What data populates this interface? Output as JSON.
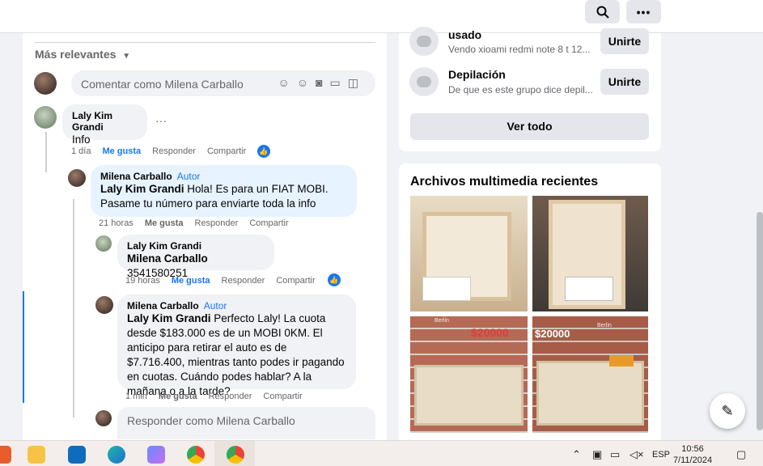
{
  "topbar": {
    "search_icon": "search-icon",
    "more_icon": "more-icon"
  },
  "comments": {
    "sort_label": "Más relevantes",
    "composer_placeholder": "Comentar como Milena Carballo",
    "reply_placeholder": "Responder como Milena Carballo",
    "items": [
      {
        "author": "Laly Kim Grandi",
        "badge": "",
        "mention": "",
        "text": "Info",
        "time": "1 día",
        "like": "Me gusta",
        "reply": "Responder",
        "share": "Compartir"
      },
      {
        "author": "Milena Carballo",
        "badge": "Autor",
        "mention": "Laly Kim Grandi",
        "text": " Hola! Es para un FIAT MOBI. Pasame tu número para enviarte toda la info",
        "time": "21 horas",
        "like": "Me gusta",
        "reply": "Responder",
        "share": "Compartir"
      },
      {
        "author": "Laly Kim Grandi",
        "badge": "",
        "mention": "Milena Carballo",
        "text": " 3541580251",
        "time": "19 horas",
        "like": "Me gusta",
        "reply": "Responder",
        "share": "Compartir"
      },
      {
        "author": "Milena Carballo",
        "badge": "Autor",
        "mention": "Laly Kim Grandi",
        "text": " Perfecto Laly! La cuota desde $183.000 es de un MOBI 0KM. El anticipo para retirar el auto es de $7.716.400, mientras tanto podes ir pagando en cuotas. Cuándo podes hablar? A la mañana o a la tarde?",
        "time": "1 min",
        "like": "Me gusta",
        "reply": "Responder",
        "share": "Compartir"
      }
    ]
  },
  "groups": {
    "items": [
      {
        "title": "usado",
        "subtitle": "Vendo xioami redmi note 8 t 12...",
        "join": "Unirte"
      },
      {
        "title": "Depilación",
        "subtitle": "De que es este grupo dice depil...",
        "join": "Unirte"
      }
    ],
    "see_all": "Ver todo"
  },
  "media": {
    "title": "Archivos multimedia recientes",
    "price_tags": [
      "$20000",
      "$20000"
    ],
    "caption": "Berlin"
  },
  "taskbar": {
    "language": "ESP",
    "time": "10:56",
    "date": "7/11/2024"
  },
  "colors": {
    "accent": "#1877f2",
    "secondary_text": "#65676b",
    "bubble": "#f0f2f5",
    "author_bubble": "#e7f3ff"
  }
}
